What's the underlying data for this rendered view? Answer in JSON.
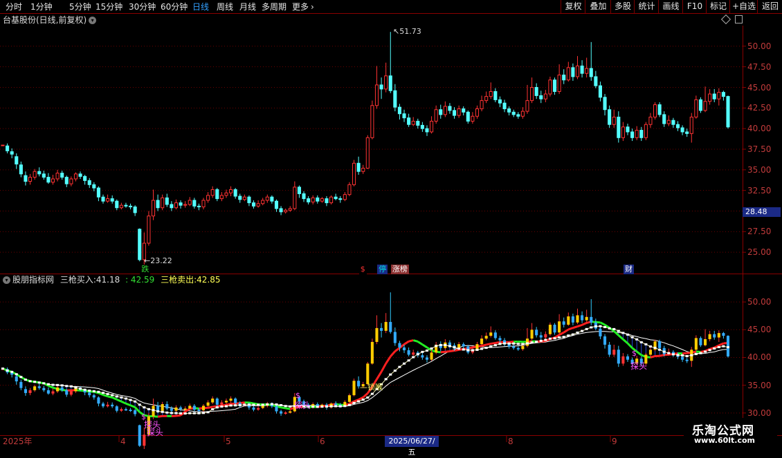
{
  "toolbar": {
    "left_items": [
      {
        "label": "分时",
        "active": false
      },
      {
        "label": "1分钟",
        "active": false
      },
      {
        "label": "5分钟",
        "active": false
      },
      {
        "label": "15分钟",
        "active": false
      },
      {
        "label": "30分钟",
        "active": false
      },
      {
        "label": "60分钟",
        "active": false
      },
      {
        "label": "日线",
        "active": true
      },
      {
        "label": "周线",
        "active": false
      },
      {
        "label": "月线",
        "active": false
      },
      {
        "label": "多周期",
        "active": false
      },
      {
        "label": "更多",
        "active": false
      }
    ],
    "more_chevron": "chevron-right-icon",
    "right_items": [
      "复权",
      "叠加",
      "多股",
      "统计",
      "画线",
      "F10",
      "标记",
      "+自选",
      "返回"
    ]
  },
  "chart_header": {
    "stock_name": "台基股份(日线,前复权)",
    "dropdown_icon": "chevron-down-icon",
    "diamond_icon": "diamond-icon",
    "layout_icon": "layout-icon"
  },
  "price_axis": {
    "labels": [
      "50.00",
      "47.50",
      "45.00",
      "42.50",
      "40.00",
      "37.50",
      "35.00",
      "32.50",
      "30.00",
      "27.50",
      "25.00"
    ],
    "current_price": "28.48"
  },
  "annotations": {
    "high_label": "51.73",
    "low_label": "23.22"
  },
  "markers": [
    {
      "text": "跌",
      "color": "#33e033",
      "bg": "#000"
    },
    {
      "text": "$",
      "color": "#ff3333",
      "bg": "#000"
    },
    {
      "text": "停",
      "color": "#00e0e0",
      "bg": "#1b2a86"
    },
    {
      "text": "涨榜",
      "color": "#ffffff",
      "bg": "#8b2f2f"
    },
    {
      "text": "财",
      "color": "#ffffff",
      "bg": "#1b2a86"
    }
  ],
  "indicator": {
    "name": "股朋指标网",
    "buy_label": "三枪买入:",
    "buy_value": "41.18",
    "sep_value": ": 42.59",
    "sell_label": "三枪卖出:",
    "sell_value": "42.85",
    "axis_labels": [
      "50.00",
      "45.00",
      "40.00",
      "35.00",
      "30.00"
    ],
    "signal_tantou": "探头",
    "signal_suohou": "锁喉",
    "dollar": "$"
  },
  "date_axis": {
    "labels": [
      "2025年",
      "4",
      "5",
      "6",
      "8",
      "9"
    ],
    "cursor_date": "2025/06/27/五"
  },
  "watermark": {
    "line1": "乐淘公式网",
    "line2": "www.60lt.com"
  },
  "colors": {
    "up": "#ff3333",
    "down": "#54ffff",
    "grid": "#6e0000",
    "axis_text": "#c23b3b",
    "green_line": "#22ee22",
    "red_line": "#ff2020",
    "white_line": "#ffffff",
    "accent_blue": "#1b2a86"
  },
  "chart_data": {
    "type": "candlestick",
    "y_range": [
      22.5,
      52.5
    ],
    "indicator_y_range": [
      26,
      53
    ],
    "candles": [
      [
        38.0,
        38.0,
        38.0,
        38.0
      ],
      [
        37.9,
        37.3,
        38.2,
        37.0
      ],
      [
        37.2,
        36.9,
        37.6,
        36.4
      ],
      [
        36.6,
        35.7,
        37.0,
        35.1
      ],
      [
        35.6,
        34.5,
        36.0,
        34.1
      ],
      [
        34.3,
        33.6,
        34.8,
        33.1
      ],
      [
        33.6,
        34.1,
        34.5,
        33.2
      ],
      [
        34.1,
        34.8,
        35.1,
        33.8
      ],
      [
        34.8,
        34.5,
        35.3,
        34.2
      ],
      [
        34.5,
        34.1,
        34.9,
        33.8
      ],
      [
        34.1,
        33.5,
        34.6,
        33.3
      ],
      [
        33.5,
        33.9,
        34.4,
        33.2
      ],
      [
        33.9,
        34.6,
        35.0,
        33.6
      ],
      [
        34.6,
        34.1,
        34.9,
        33.8
      ],
      [
        34.1,
        33.3,
        34.3,
        32.9
      ],
      [
        33.3,
        33.9,
        34.2,
        33.0
      ],
      [
        33.9,
        34.5,
        34.7,
        33.6
      ],
      [
        34.5,
        34.2,
        34.8,
        33.9
      ],
      [
        34.2,
        33.7,
        34.4,
        33.2
      ],
      [
        33.7,
        33.2,
        34.0,
        32.8
      ],
      [
        33.2,
        32.8,
        33.5,
        32.4
      ],
      [
        32.8,
        31.7,
        33.0,
        31.2
      ],
      [
        31.7,
        31.2,
        32.0,
        30.9
      ],
      [
        31.2,
        31.5,
        32.0,
        31.0
      ],
      [
        31.5,
        31.2,
        31.9,
        30.9
      ],
      [
        31.2,
        30.4,
        31.4,
        30.1
      ],
      [
        30.4,
        30.7,
        31.0,
        30.2
      ],
      [
        30.7,
        30.6,
        31.0,
        30.4
      ],
      [
        30.6,
        30.5,
        30.9,
        30.2
      ],
      [
        30.5,
        29.8,
        30.7,
        29.4
      ],
      [
        27.8,
        24.1,
        27.9,
        23.9
      ],
      [
        24.1,
        26.1,
        27.4,
        23.22
      ],
      [
        26.1,
        29.4,
        30.0,
        25.8
      ],
      [
        29.4,
        31.3,
        32.6,
        28.9
      ],
      [
        31.3,
        30.4,
        32.0,
        30.0
      ],
      [
        30.4,
        31.6,
        32.0,
        30.1
      ],
      [
        31.6,
        30.8,
        32.1,
        30.5
      ],
      [
        30.8,
        30.4,
        31.2,
        30.0
      ],
      [
        30.4,
        31.0,
        31.4,
        30.2
      ],
      [
        31.0,
        30.7,
        31.3,
        30.3
      ],
      [
        30.7,
        30.8,
        31.2,
        30.4
      ],
      [
        30.8,
        31.3,
        31.7,
        30.6
      ],
      [
        31.3,
        30.6,
        31.6,
        30.3
      ],
      [
        30.6,
        30.5,
        30.9,
        30.1
      ],
      [
        30.5,
        31.3,
        31.6,
        30.2
      ],
      [
        31.3,
        31.9,
        32.3,
        31.0
      ],
      [
        31.9,
        32.6,
        33.0,
        31.6
      ],
      [
        32.6,
        31.5,
        32.8,
        31.2
      ],
      [
        31.5,
        31.9,
        32.3,
        31.2
      ],
      [
        31.9,
        32.2,
        32.6,
        31.6
      ],
      [
        32.2,
        32.6,
        33.0,
        31.8
      ],
      [
        32.6,
        31.8,
        32.8,
        31.5
      ],
      [
        31.8,
        31.4,
        32.1,
        31.0
      ],
      [
        31.4,
        31.7,
        32.0,
        31.2
      ],
      [
        31.7,
        31.0,
        31.9,
        30.6
      ],
      [
        31.0,
        30.6,
        31.3,
        30.3
      ],
      [
        30.6,
        30.9,
        31.3,
        30.4
      ],
      [
        30.9,
        31.3,
        31.6,
        30.7
      ],
      [
        31.3,
        31.7,
        32.0,
        31.0
      ],
      [
        31.7,
        31.2,
        31.9,
        30.9
      ],
      [
        31.2,
        30.3,
        31.4,
        29.9
      ],
      [
        30.3,
        29.9,
        30.6,
        29.5
      ],
      [
        29.9,
        30.1,
        30.3,
        29.7
      ],
      [
        30.1,
        30.3,
        30.6,
        29.9
      ],
      [
        30.3,
        32.9,
        33.6,
        30.1
      ],
      [
        32.9,
        32.1,
        33.1,
        31.6
      ],
      [
        32.1,
        31.5,
        32.4,
        31.1
      ],
      [
        31.5,
        31.1,
        31.8,
        30.8
      ],
      [
        31.1,
        31.6,
        31.9,
        30.8
      ],
      [
        31.6,
        31.2,
        31.9,
        30.9
      ],
      [
        31.2,
        31.5,
        31.7,
        31.0
      ],
      [
        31.5,
        31.0,
        31.8,
        30.6
      ],
      [
        31.0,
        31.7,
        31.9,
        30.8
      ],
      [
        31.7,
        31.5,
        32.1,
        31.3
      ],
      [
        31.5,
        31.4,
        31.8,
        31.0
      ],
      [
        31.4,
        32.0,
        32.3,
        31.2
      ],
      [
        32.0,
        33.2,
        33.5,
        31.8
      ],
      [
        33.2,
        35.8,
        36.2,
        33.0
      ],
      [
        35.8,
        34.8,
        36.6,
        34.4
      ],
      [
        34.8,
        35.2,
        35.6,
        34.5
      ],
      [
        35.2,
        38.9,
        39.2,
        35.1
      ],
      [
        38.9,
        42.8,
        43.4,
        38.7
      ],
      [
        42.8,
        45.3,
        47.6,
        42.4
      ],
      [
        45.3,
        44.8,
        46.2,
        43.6
      ],
      [
        44.8,
        46.4,
        48.0,
        44.4
      ],
      [
        46.4,
        44.6,
        51.73,
        44.3
      ],
      [
        44.6,
        42.6,
        45.4,
        42.1
      ],
      [
        42.6,
        41.8,
        43.0,
        41.1
      ],
      [
        41.8,
        41.3,
        42.3,
        40.8
      ],
      [
        41.3,
        40.5,
        41.8,
        40.2
      ],
      [
        40.5,
        40.9,
        41.4,
        40.3
      ],
      [
        40.9,
        40.4,
        41.2,
        40.0
      ],
      [
        40.4,
        40.0,
        40.8,
        39.6
      ],
      [
        40.0,
        39.6,
        40.4,
        39.1
      ],
      [
        39.6,
        40.9,
        41.5,
        39.4
      ],
      [
        40.9,
        42.3,
        42.8,
        40.6
      ],
      [
        42.3,
        41.7,
        42.9,
        41.2
      ],
      [
        41.7,
        42.7,
        43.3,
        41.4
      ],
      [
        42.7,
        42.2,
        43.1,
        41.8
      ],
      [
        42.2,
        41.6,
        42.6,
        41.2
      ],
      [
        41.6,
        42.4,
        42.8,
        41.3
      ],
      [
        42.4,
        42.0,
        42.7,
        41.6
      ],
      [
        42.0,
        40.9,
        42.2,
        40.6
      ],
      [
        40.9,
        41.5,
        42.0,
        40.6
      ],
      [
        41.5,
        42.4,
        42.8,
        41.2
      ],
      [
        42.4,
        43.4,
        44.0,
        42.1
      ],
      [
        43.4,
        43.9,
        44.5,
        43.1
      ],
      [
        43.9,
        44.5,
        45.6,
        43.6
      ],
      [
        44.5,
        43.5,
        44.9,
        43.2
      ],
      [
        43.5,
        43.1,
        43.9,
        42.6
      ],
      [
        43.1,
        42.4,
        43.5,
        42.0
      ],
      [
        42.4,
        42.0,
        42.7,
        41.6
      ],
      [
        42.0,
        41.7,
        42.3,
        41.4
      ],
      [
        41.7,
        41.5,
        42.0,
        41.2
      ],
      [
        41.5,
        42.1,
        42.6,
        41.2
      ],
      [
        42.1,
        43.4,
        45.3,
        41.8
      ],
      [
        43.4,
        45.0,
        46.2,
        43.1
      ],
      [
        45.0,
        44.0,
        45.5,
        43.6
      ],
      [
        44.0,
        43.6,
        44.6,
        43.1
      ],
      [
        43.6,
        44.2,
        44.7,
        43.2
      ],
      [
        44.2,
        45.9,
        46.3,
        43.9
      ],
      [
        45.9,
        44.5,
        46.2,
        44.1
      ],
      [
        44.5,
        46.5,
        47.8,
        44.2
      ],
      [
        46.5,
        45.9,
        47.2,
        45.4
      ],
      [
        45.9,
        47.4,
        48.1,
        45.7
      ],
      [
        47.4,
        46.3,
        47.9,
        45.8
      ],
      [
        46.3,
        47.6,
        48.8,
        46.0
      ],
      [
        47.6,
        46.7,
        48.3,
        46.2
      ],
      [
        46.7,
        47.3,
        48.6,
        46.2
      ],
      [
        47.3,
        46.3,
        50.5,
        45.8
      ],
      [
        46.3,
        45.2,
        47.0,
        44.9
      ],
      [
        45.2,
        43.8,
        45.7,
        43.3
      ],
      [
        43.8,
        42.3,
        44.2,
        41.6
      ],
      [
        42.3,
        40.5,
        42.8,
        40.1
      ],
      [
        40.5,
        41.4,
        42.3,
        40.1
      ],
      [
        41.4,
        38.9,
        42.1,
        38.3
      ],
      [
        38.9,
        40.2,
        40.8,
        38.5
      ],
      [
        40.2,
        39.6,
        40.6,
        39.2
      ],
      [
        39.6,
        38.9,
        40.0,
        38.5
      ],
      [
        38.9,
        39.8,
        40.3,
        38.6
      ],
      [
        39.8,
        38.9,
        40.2,
        38.5
      ],
      [
        38.9,
        40.5,
        40.8,
        38.6
      ],
      [
        40.5,
        41.4,
        41.9,
        40.1
      ],
      [
        41.4,
        42.9,
        43.2,
        41.1
      ],
      [
        42.9,
        41.7,
        43.2,
        41.4
      ],
      [
        41.7,
        40.6,
        42.1,
        40.2
      ],
      [
        40.6,
        41.0,
        41.6,
        40.3
      ],
      [
        41.0,
        40.5,
        41.3,
        40.1
      ],
      [
        40.5,
        40.1,
        40.9,
        39.7
      ],
      [
        40.1,
        39.6,
        40.4,
        39.2
      ],
      [
        39.6,
        39.4,
        40.0,
        39.0
      ],
      [
        39.4,
        41.4,
        41.9,
        38.3
      ],
      [
        41.4,
        43.5,
        44.0,
        41.2
      ],
      [
        43.5,
        42.2,
        43.8,
        41.9
      ],
      [
        42.2,
        43.3,
        45.1,
        42.0
      ],
      [
        43.3,
        44.2,
        44.8,
        42.9
      ],
      [
        44.2,
        43.6,
        44.8,
        43.2
      ],
      [
        43.6,
        44.4,
        44.9,
        42.8
      ],
      [
        44.4,
        43.9,
        44.6,
        43.4
      ],
      [
        43.9,
        40.2,
        44.0,
        40.0
      ]
    ],
    "markers_x": [
      "跌@31",
      "$@79",
      "停@83",
      "涨榜@86",
      "财@137"
    ]
  }
}
